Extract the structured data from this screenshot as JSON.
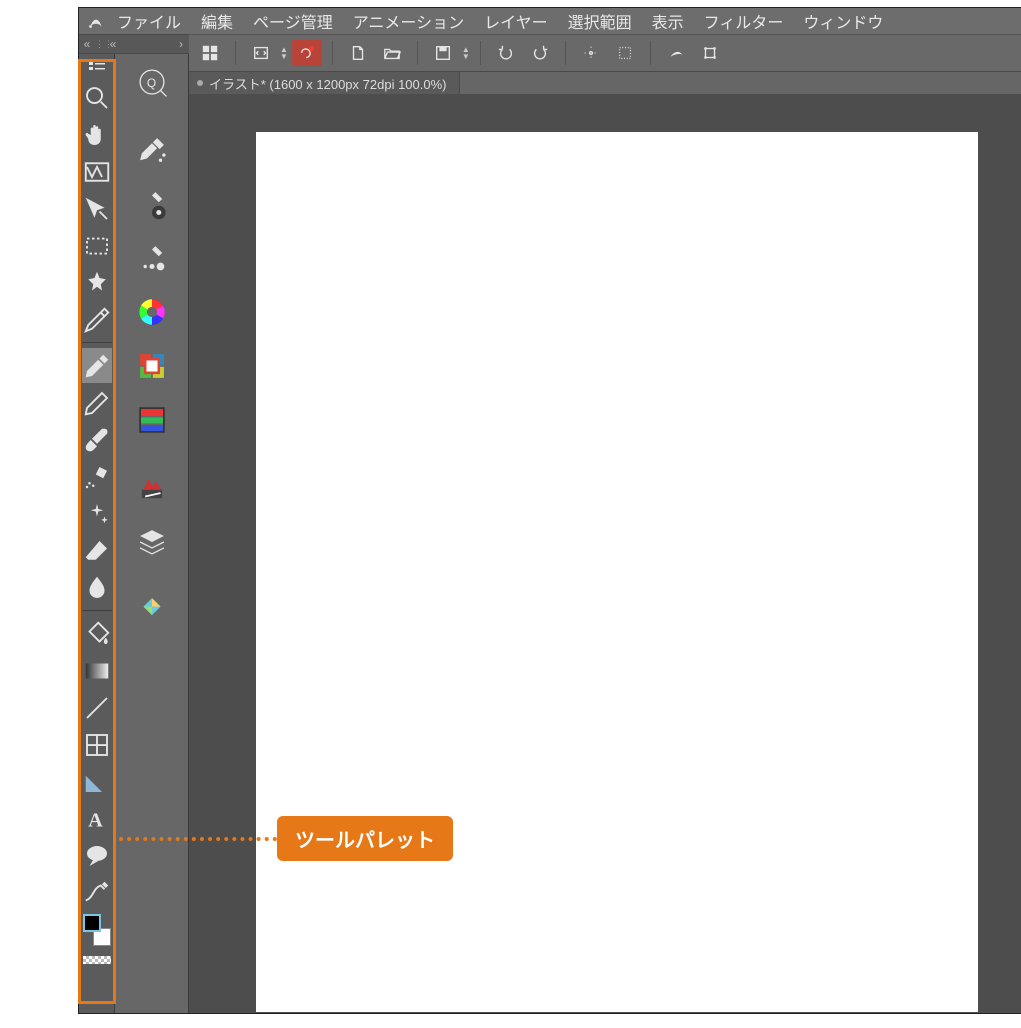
{
  "menu": {
    "items": [
      "ファイル",
      "編集",
      "ページ管理",
      "アニメーション",
      "レイヤー",
      "選択範囲",
      "表示",
      "フィルター",
      "ウィンドウ"
    ]
  },
  "doc": {
    "title": "イラスト* (1600 x 1200px 72dpi 100.0%)"
  },
  "callout": {
    "label": "ツールパレット"
  },
  "toolsA": [
    {
      "name": "magnify-icon"
    },
    {
      "name": "hand-icon"
    },
    {
      "name": "rotate-view-icon"
    },
    {
      "name": "move-layer-icon"
    },
    {
      "name": "marquee-icon"
    },
    {
      "name": "wand-icon"
    },
    {
      "name": "eyedropper-icon"
    },
    {
      "name": "pen-icon"
    },
    {
      "name": "pencil-icon"
    },
    {
      "name": "brush-icon"
    },
    {
      "name": "airbrush-icon"
    },
    {
      "name": "sparkle-icon"
    },
    {
      "name": "eraser-icon"
    },
    {
      "name": "blend-drop-icon"
    },
    {
      "name": "fill-icon"
    },
    {
      "name": "gradient-icon"
    },
    {
      "name": "line-icon"
    },
    {
      "name": "frame-icon"
    },
    {
      "name": "ruler-triangle-icon"
    },
    {
      "name": "text-icon"
    },
    {
      "name": "balloon-icon"
    },
    {
      "name": "correct-line-icon"
    }
  ],
  "toolsB": [
    {
      "name": "quick-access-icon"
    },
    {
      "name": "subtool-detail-icon"
    },
    {
      "name": "brush-size-icon"
    },
    {
      "name": "brush-shape-icon"
    },
    {
      "name": "color-wheel-icon"
    },
    {
      "name": "color-set-icon"
    },
    {
      "name": "color-slider-icon"
    },
    {
      "name": "approve-icon"
    },
    {
      "name": "layers-icon"
    },
    {
      "name": "material-icon"
    }
  ],
  "cmd": [
    {
      "name": "grid-view-icon"
    },
    {
      "name": "flip-canvas-icon"
    },
    {
      "name": "spin-1"
    },
    {
      "name": "record-icon"
    },
    {
      "name": "new-file-icon"
    },
    {
      "name": "open-folder-icon"
    },
    {
      "name": "save-icon"
    },
    {
      "name": "spin-2"
    },
    {
      "name": "undo-icon"
    },
    {
      "name": "redo-icon"
    },
    {
      "name": "snap-target-icon"
    },
    {
      "name": "snap-grid-icon"
    },
    {
      "name": "clear-icon"
    },
    {
      "name": "transform-icon"
    }
  ],
  "colors": {
    "accent": "#e67817"
  }
}
